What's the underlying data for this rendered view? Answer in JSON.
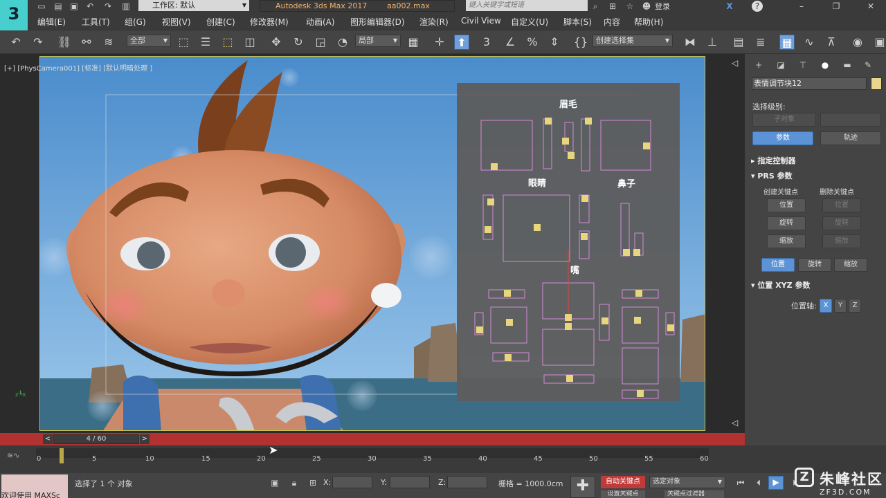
{
  "titlebar": {
    "workspace": "工作区: 默认",
    "app_name": "Autodesk 3ds Max 2017",
    "file_name": "aa002.max",
    "search_placeholder": "键入关键字或短语",
    "login": "登录",
    "logo": "3"
  },
  "menu": [
    "编辑(E)",
    "工具(T)",
    "组(G)",
    "视图(V)",
    "创建(C)",
    "修改器(M)",
    "动画(A)",
    "图形编辑器(D)",
    "渲染(R)",
    "Civil View",
    "自定义(U)",
    "脚本(S)",
    "内容",
    "帮助(H)"
  ],
  "toolbar": {
    "filter": "全部",
    "refcoord": "局部",
    "selset": "创建选择集"
  },
  "viewport": {
    "label": "[+] [PhysCamera001] [标准] [默认明暗处理 ]",
    "panel_labels": {
      "eyebrow": "眉毛",
      "eyes": "眼睛",
      "nose": "鼻子",
      "mouth": "嘴"
    }
  },
  "command_panel": {
    "object_name": "表情调节块12",
    "selection_level": "选择级别:",
    "sub_object": "子对象",
    "params_tab": "参数",
    "track_tab": "轨迹",
    "rollout_controller": "指定控制器",
    "rollout_prs": "PRS 参数",
    "create_key": "创建关键点",
    "delete_key": "删除关键点",
    "pos": "位置",
    "rot": "旋转",
    "scale": "缩放",
    "rollout_xyz": "位置 XYZ 参数",
    "pos_axis": "位置轴:",
    "axis_x": "X",
    "axis_y": "Y",
    "axis_z": "Z"
  },
  "timeline": {
    "frame": "4 / 60",
    "ticks": [
      "0",
      "5",
      "10",
      "15",
      "20",
      "25",
      "30",
      "35",
      "40",
      "45",
      "50",
      "55",
      "60"
    ]
  },
  "status": {
    "welcome": "欢迎使用 MAXSc",
    "selected": "选择了 1 个 对象",
    "x_label": "X:",
    "y_label": "Y:",
    "z_label": "Z:",
    "grid": "栅格 = 1000.0cm",
    "autokey": "自动关键点",
    "selected_obj": "选定对象",
    "setkey": "设置关键点",
    "keyfilter": "关键点过滤器"
  },
  "watermark": {
    "brand": "朱峰社区",
    "url": "ZF3D.COM"
  },
  "colors": {
    "accent": "#5b93d6",
    "timebar": "#b23131",
    "autokey": "#c03a3a"
  }
}
